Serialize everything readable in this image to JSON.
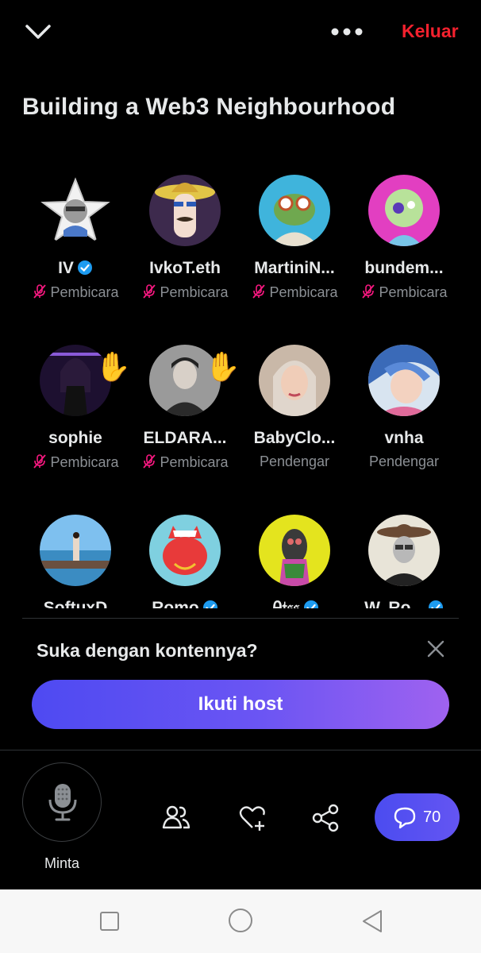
{
  "header": {
    "collapse_icon": "chevron-down-icon",
    "more_icon": "more-horizontal-icon",
    "leave_label": "Keluar",
    "leave_color": "#f4212e"
  },
  "space": {
    "title": "Building a Web3 Neighbourhood"
  },
  "participants": [
    {
      "name": "IV",
      "verified": true,
      "role": "Pembicara",
      "muted": true,
      "hand": false
    },
    {
      "name": "IvkoT.eth",
      "verified": false,
      "role": "Pembicara",
      "muted": true,
      "hand": false
    },
    {
      "name": "MartiniN...",
      "verified": false,
      "role": "Pembicara",
      "muted": true,
      "hand": false
    },
    {
      "name": "bundem...",
      "verified": false,
      "role": "Pembicara",
      "muted": true,
      "hand": false
    },
    {
      "name": "sophie",
      "verified": false,
      "role": "Pembicara",
      "muted": true,
      "hand": true
    },
    {
      "name": "ELDARA...",
      "verified": false,
      "role": "Pembicara",
      "muted": true,
      "hand": true
    },
    {
      "name": "BabyClo...",
      "verified": false,
      "role": "Pendengar",
      "muted": false,
      "hand": false
    },
    {
      "name": "vnha",
      "verified": false,
      "role": "Pendengar",
      "muted": false,
      "hand": false
    },
    {
      "name": "SoftuxD",
      "verified": false,
      "role": "",
      "muted": false,
      "hand": false
    },
    {
      "name": "Romo",
      "verified": true,
      "role": "",
      "muted": false,
      "hand": false
    },
    {
      "name": "Ꭿ𝔱𝔰𝔰",
      "verified": true,
      "role": "",
      "muted": false,
      "hand": false
    },
    {
      "name": "W. Ro...",
      "verified": true,
      "role": "",
      "muted": false,
      "hand": false
    }
  ],
  "prompt": {
    "question": "Suka dengan kontennya?",
    "follow_label": "Ikuti host",
    "close_icon": "close-icon"
  },
  "bottom": {
    "mic_label": "Minta",
    "people_icon": "people-icon",
    "like_icon": "heart-plus-icon",
    "share_icon": "share-icon",
    "comments_count": "70",
    "accent": "#4b4cf0"
  },
  "navbar": {
    "recents_icon": "square-icon",
    "home_icon": "circle-icon",
    "back_icon": "triangle-back-icon"
  }
}
